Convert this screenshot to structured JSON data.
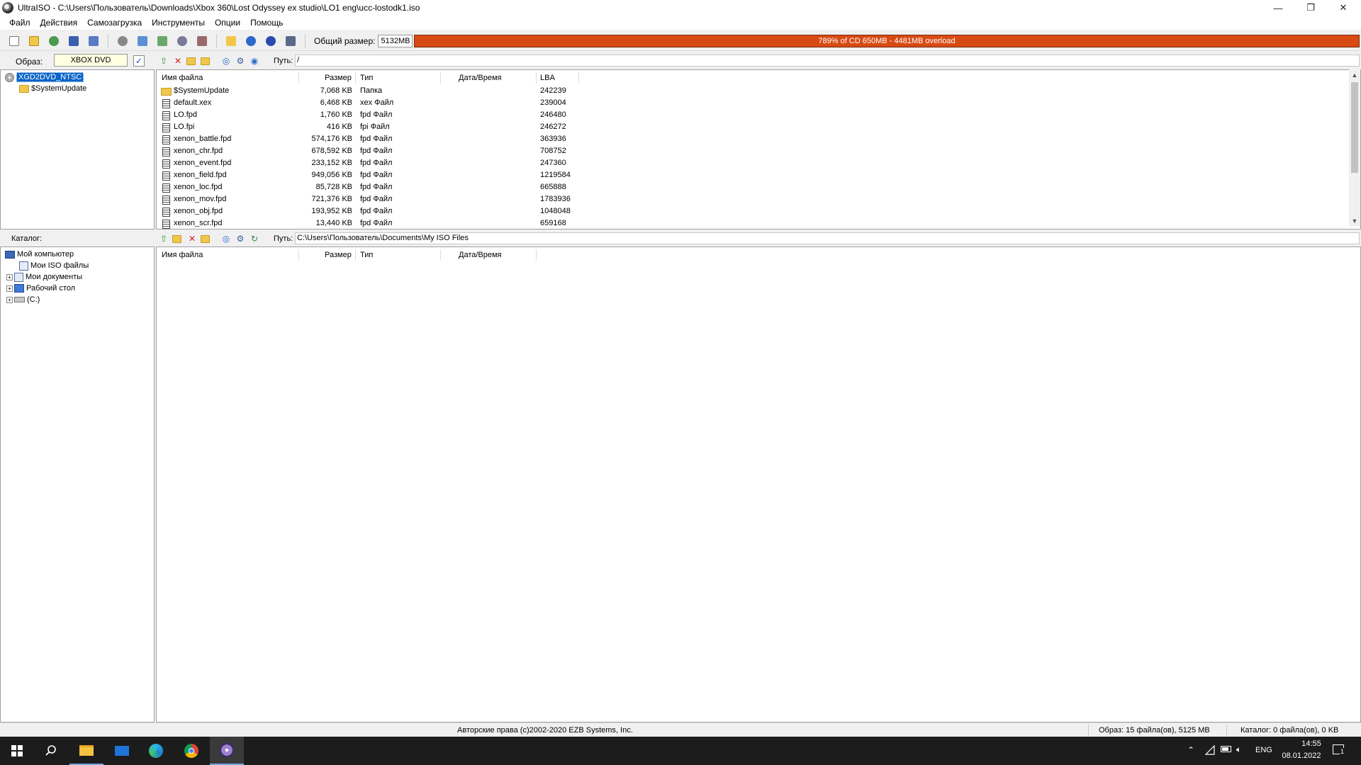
{
  "window": {
    "title": "UltraISO - C:\\Users\\Пользователь\\Downloads\\Xbox 360\\Lost Odyssey ex studio\\LO1 eng\\ucc-lostodk1.iso",
    "minimize": "—",
    "restore": "❐",
    "close": "✕"
  },
  "menu": [
    "Файл",
    "Действия",
    "Самозагрузка",
    "Инструменты",
    "Опции",
    "Помощь"
  ],
  "toolbar": {
    "size_label": "Общий размер:",
    "size_value": "5132MB",
    "capacity_text": "789% of CD 650MB - 4481MB overload",
    "capacity_color": "#d84a14"
  },
  "image_row": {
    "label": "Образ:",
    "type": "XBOX DVD",
    "path_label": "Путь:",
    "path": "/"
  },
  "iso_tree": {
    "root": "XGD2DVD_NTSC",
    "children": [
      "$SystemUpdate"
    ]
  },
  "iso_list": {
    "columns": [
      "Имя файла",
      "Размер",
      "Тип",
      "Дата/Время",
      "LBA"
    ],
    "rows": [
      {
        "name": "$SystemUpdate",
        "size": "7,068 KB",
        "type": "Папка",
        "date": "",
        "lba": "242239",
        "folder": true
      },
      {
        "name": "default.xex",
        "size": "6,468 KB",
        "type": "xex Файл",
        "date": "",
        "lba": "239004",
        "folder": false
      },
      {
        "name": "LO.fpd",
        "size": "1,760 KB",
        "type": "fpd Файл",
        "date": "",
        "lba": "246480",
        "folder": false
      },
      {
        "name": "LO.fpi",
        "size": "416 KB",
        "type": "fpi Файл",
        "date": "",
        "lba": "246272",
        "folder": false
      },
      {
        "name": "xenon_battle.fpd",
        "size": "574,176 KB",
        "type": "fpd Файл",
        "date": "",
        "lba": "363936",
        "folder": false
      },
      {
        "name": "xenon_chr.fpd",
        "size": "678,592 KB",
        "type": "fpd Файл",
        "date": "",
        "lba": "708752",
        "folder": false
      },
      {
        "name": "xenon_event.fpd",
        "size": "233,152 KB",
        "type": "fpd Файл",
        "date": "",
        "lba": "247360",
        "folder": false
      },
      {
        "name": "xenon_field.fpd",
        "size": "949,056 KB",
        "type": "fpd Файл",
        "date": "",
        "lba": "1219584",
        "folder": false
      },
      {
        "name": "xenon_loc.fpd",
        "size": "85,728 KB",
        "type": "fpd Файл",
        "date": "",
        "lba": "665888",
        "folder": false
      },
      {
        "name": "xenon_mov.fpd",
        "size": "721,376 KB",
        "type": "fpd Файл",
        "date": "",
        "lba": "1783936",
        "folder": false
      },
      {
        "name": "xenon_obj.fpd",
        "size": "193,952 KB",
        "type": "fpd Файл",
        "date": "",
        "lba": "1048048",
        "folder": false
      },
      {
        "name": "xenon_scr.fpd",
        "size": "13,440 KB",
        "type": "fpd Файл",
        "date": "",
        "lba": "659168",
        "folder": false
      }
    ]
  },
  "catalog_row": {
    "label": "Каталог:",
    "path_label": "Путь:",
    "path": "C:\\Users\\Пользователь\\Documents\\My ISO Files"
  },
  "local_tree": {
    "root": "Мой компьютер",
    "items": [
      "Мои ISO файлы",
      "Мои документы",
      "Рабочий стол",
      "(C:)"
    ]
  },
  "local_list": {
    "columns": [
      "Имя файла",
      "Размер",
      "Тип",
      "Дата/Время"
    ]
  },
  "status": {
    "copyright": "Авторские права (c)2002-2020 EZB Systems, Inc.",
    "image_info": "Образ: 15 файла(ов), 5125 MB",
    "catalog_info": "Каталог: 0 файла(ов), 0 KB"
  },
  "taskbar": {
    "language": "ENG",
    "time": "14:55",
    "date": "08.01.2022",
    "notifications": "1"
  }
}
